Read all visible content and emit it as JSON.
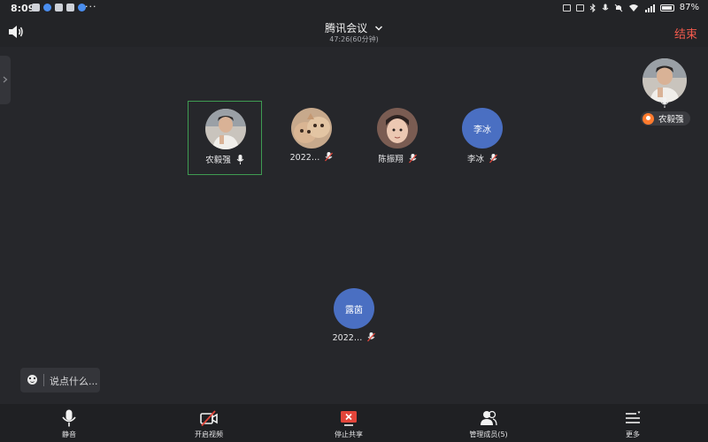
{
  "status_bar": {
    "time": "8:09",
    "battery_percent": "87%",
    "overflow": "···"
  },
  "header": {
    "speaker_icon": "speaker-icon",
    "title": "腾讯会议",
    "timer": "47:26(60分钟)",
    "end_label": "结束",
    "end_color": "#f25a4c"
  },
  "participants": [
    {
      "name": "农毅强",
      "avatar": "photo-man",
      "mic": "on",
      "active": true
    },
    {
      "name": "2022…",
      "avatar": "photo-cat",
      "mic": "muted",
      "active": false
    },
    {
      "name": "陈振翔",
      "avatar": "photo-child",
      "mic": "muted",
      "active": false
    },
    {
      "name": "李冰",
      "avatar_text": "李冰",
      "mic": "muted",
      "active": false
    },
    {
      "name": "2022…",
      "avatar_text": "露茵",
      "mic": "muted",
      "active": false
    }
  ],
  "self_view": {
    "name": "农毅强",
    "avatar": "photo-man",
    "badge_color": "#ff7b2e"
  },
  "chat": {
    "placeholder": "说点什么..."
  },
  "toolbar": {
    "mute_label": "静音",
    "video_label": "开启视频",
    "share_label": "停止共享",
    "members_label": "管理成员(5)",
    "more_label": "更多"
  },
  "colors": {
    "background": "#26272b",
    "active_border": "#3f9b52",
    "text_avatar": "#4a6fc2",
    "share_red": "#e2453a"
  }
}
